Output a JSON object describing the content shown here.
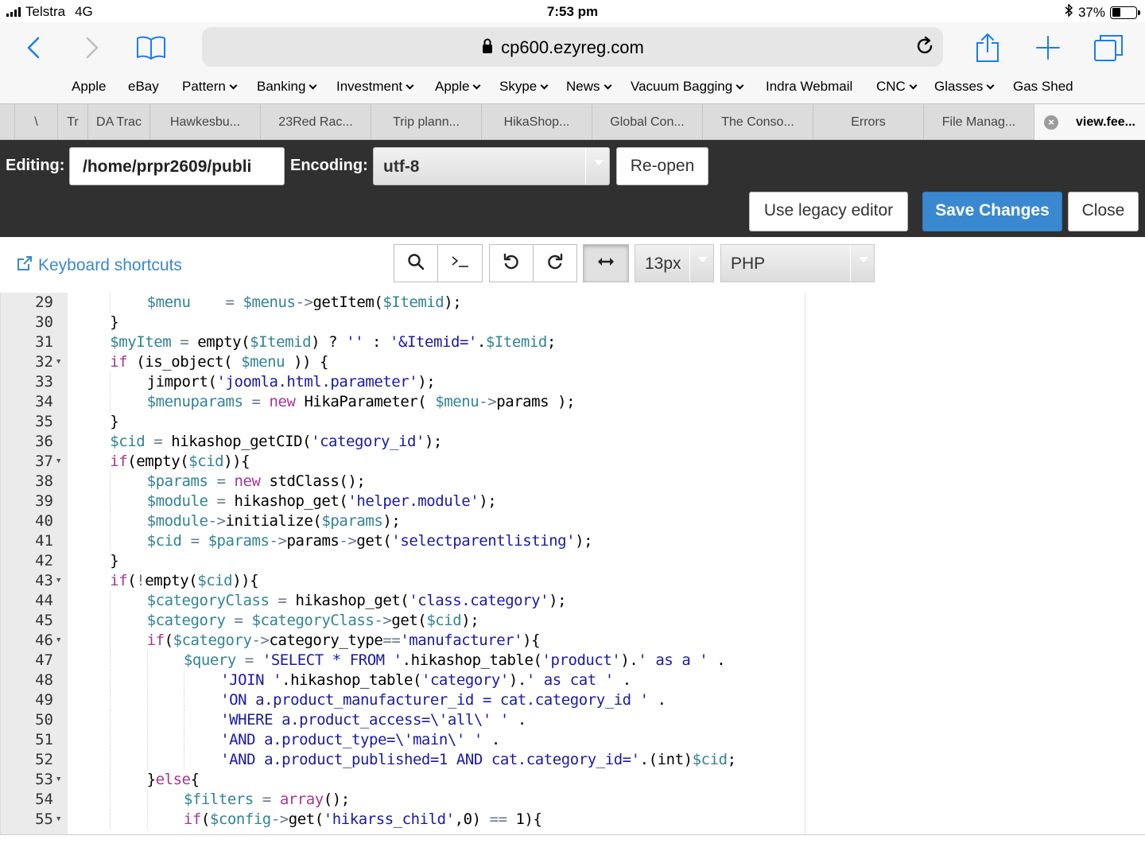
{
  "status_bar": {
    "carrier": "Telstra",
    "network": "4G",
    "time": "7:53 pm",
    "battery": "37%",
    "battery_level": 0.37
  },
  "browser": {
    "url": "cp600.ezyreg.com",
    "favorites": [
      {
        "label": "Apple",
        "dropdown": false
      },
      {
        "label": "eBay",
        "dropdown": false
      },
      {
        "label": "Pattern",
        "dropdown": true
      },
      {
        "label": "Banking",
        "dropdown": true
      },
      {
        "label": "Investment",
        "dropdown": true
      },
      {
        "label": "Apple",
        "dropdown": true
      },
      {
        "label": "Skype",
        "dropdown": true
      },
      {
        "label": "News",
        "dropdown": true
      },
      {
        "label": "Vacuum Bagging",
        "dropdown": true
      },
      {
        "label": "Indra Webmail",
        "dropdown": false
      },
      {
        "label": "CNC",
        "dropdown": true
      },
      {
        "label": "Glasses",
        "dropdown": true
      },
      {
        "label": "Gas Shed",
        "dropdown": false
      }
    ],
    "tabs": [
      {
        "label": "\\"
      },
      {
        "label": "Tr"
      },
      {
        "label": "DA Trac"
      },
      {
        "label": "Hawkesbu..."
      },
      {
        "label": "23Red Rac..."
      },
      {
        "label": "Trip plann..."
      },
      {
        "label": "HikaShop..."
      },
      {
        "label": "Global Con..."
      },
      {
        "label": "The Conso..."
      },
      {
        "label": "Errors"
      },
      {
        "label": "File Manag..."
      },
      {
        "label": "view.fee..."
      }
    ]
  },
  "editor_header": {
    "editing_label": "Editing:",
    "path": "/home/prpr2609/publi",
    "encoding_label": "Encoding:",
    "encoding": "utf-8",
    "reopen": "Re-open",
    "legacy": "Use legacy editor",
    "save": "Save Changes",
    "close": "Close"
  },
  "toolbar": {
    "shortcuts": "Keyboard shortcuts",
    "font_size": "13px",
    "mode": "PHP"
  },
  "code_lines": [
    {
      "n": "29",
      "fold": false,
      "indent": 2,
      "tokens": [
        [
          "var",
          "$menu"
        ],
        [
          "",
          "    "
        ],
        [
          "op",
          "="
        ],
        [
          "",
          " "
        ],
        [
          "var",
          "$menus"
        ],
        [
          "op",
          "->"
        ],
        [
          "",
          "getItem("
        ],
        [
          "var",
          "$Itemid"
        ],
        [
          "",
          ");"
        ]
      ]
    },
    {
      "n": "30",
      "fold": false,
      "indent": 1,
      "tokens": [
        [
          "",
          "}"
        ]
      ]
    },
    {
      "n": "31",
      "fold": false,
      "indent": 1,
      "tokens": [
        [
          "var",
          "$myItem"
        ],
        [
          "",
          " "
        ],
        [
          "op",
          "="
        ],
        [
          "",
          " empty("
        ],
        [
          "var",
          "$Itemid"
        ],
        [
          "",
          ") ? "
        ],
        [
          "str",
          "''"
        ],
        [
          "",
          " : "
        ],
        [
          "str",
          "'&Itemid='"
        ],
        [
          "",
          "."
        ],
        [
          "var",
          "$Itemid"
        ],
        [
          "",
          ";"
        ]
      ]
    },
    {
      "n": "32",
      "fold": true,
      "indent": 1,
      "tokens": [
        [
          "kw",
          "if"
        ],
        [
          "",
          " (is_object( "
        ],
        [
          "var",
          "$menu"
        ],
        [
          "",
          " )) {"
        ]
      ]
    },
    {
      "n": "33",
      "fold": false,
      "indent": 2,
      "tokens": [
        [
          "",
          "jimport("
        ],
        [
          "str",
          "'joomla.html.parameter'"
        ],
        [
          "",
          ");"
        ]
      ]
    },
    {
      "n": "34",
      "fold": false,
      "indent": 2,
      "tokens": [
        [
          "var",
          "$menuparams"
        ],
        [
          "",
          " "
        ],
        [
          "op",
          "="
        ],
        [
          "",
          " "
        ],
        [
          "kw",
          "new"
        ],
        [
          "",
          " HikaParameter( "
        ],
        [
          "var",
          "$menu"
        ],
        [
          "op",
          "->"
        ],
        [
          "",
          "params );"
        ]
      ]
    },
    {
      "n": "35",
      "fold": false,
      "indent": 1,
      "tokens": [
        [
          "",
          "}"
        ]
      ]
    },
    {
      "n": "36",
      "fold": false,
      "indent": 1,
      "tokens": [
        [
          "var",
          "$cid"
        ],
        [
          "",
          " "
        ],
        [
          "op",
          "="
        ],
        [
          "",
          " hikashop_getCID("
        ],
        [
          "str",
          "'category_id'"
        ],
        [
          "",
          ");"
        ]
      ]
    },
    {
      "n": "37",
      "fold": true,
      "indent": 1,
      "tokens": [
        [
          "kw",
          "if"
        ],
        [
          "",
          "(empty("
        ],
        [
          "var",
          "$cid"
        ],
        [
          "",
          "))"
        ],
        [
          "",
          "{"
        ]
      ]
    },
    {
      "n": "38",
      "fold": false,
      "indent": 2,
      "tokens": [
        [
          "var",
          "$params"
        ],
        [
          "",
          " "
        ],
        [
          "op",
          "="
        ],
        [
          "",
          " "
        ],
        [
          "kw",
          "new"
        ],
        [
          "",
          " stdClass();"
        ]
      ]
    },
    {
      "n": "39",
      "fold": false,
      "indent": 2,
      "tokens": [
        [
          "var",
          "$module"
        ],
        [
          "",
          " "
        ],
        [
          "op",
          "="
        ],
        [
          "",
          " hikashop_get("
        ],
        [
          "str",
          "'helper.module'"
        ],
        [
          "",
          ");"
        ]
      ]
    },
    {
      "n": "40",
      "fold": false,
      "indent": 2,
      "tokens": [
        [
          "var",
          "$module"
        ],
        [
          "op",
          "->"
        ],
        [
          "",
          "initialize("
        ],
        [
          "var",
          "$params"
        ],
        [
          "",
          ");"
        ]
      ]
    },
    {
      "n": "41",
      "fold": false,
      "indent": 2,
      "tokens": [
        [
          "var",
          "$cid"
        ],
        [
          "",
          " "
        ],
        [
          "op",
          "="
        ],
        [
          "",
          " "
        ],
        [
          "var",
          "$params"
        ],
        [
          "op",
          "->"
        ],
        [
          "",
          "params"
        ],
        [
          "op",
          "->"
        ],
        [
          "",
          "get("
        ],
        [
          "str",
          "'selectparentlisting'"
        ],
        [
          "",
          ");"
        ]
      ]
    },
    {
      "n": "42",
      "fold": false,
      "indent": 1,
      "tokens": [
        [
          "",
          "}"
        ]
      ]
    },
    {
      "n": "43",
      "fold": true,
      "indent": 1,
      "tokens": [
        [
          "kw",
          "if"
        ],
        [
          "",
          "("
        ],
        [
          "op",
          "!"
        ],
        [
          "",
          "empty("
        ],
        [
          "var",
          "$cid"
        ],
        [
          "",
          "))"
        ],
        [
          "",
          "{"
        ]
      ]
    },
    {
      "n": "44",
      "fold": false,
      "indent": 2,
      "tokens": [
        [
          "var",
          "$categoryClass"
        ],
        [
          "",
          " "
        ],
        [
          "op",
          "="
        ],
        [
          "",
          " hikashop_get("
        ],
        [
          "str",
          "'class.category'"
        ],
        [
          "",
          ");"
        ]
      ]
    },
    {
      "n": "45",
      "fold": false,
      "indent": 2,
      "tokens": [
        [
          "var",
          "$category"
        ],
        [
          "",
          " "
        ],
        [
          "op",
          "="
        ],
        [
          "",
          " "
        ],
        [
          "var",
          "$categoryClass"
        ],
        [
          "op",
          "->"
        ],
        [
          "",
          "get("
        ],
        [
          "var",
          "$cid"
        ],
        [
          "",
          ");"
        ]
      ]
    },
    {
      "n": "46",
      "fold": true,
      "indent": 2,
      "tokens": [
        [
          "kw",
          "if"
        ],
        [
          "",
          "("
        ],
        [
          "var",
          "$category"
        ],
        [
          "op",
          "->"
        ],
        [
          "",
          "category_type"
        ],
        [
          "op",
          "=="
        ],
        [
          "str",
          "'manufacturer'"
        ],
        [
          "",
          "){"
        ]
      ]
    },
    {
      "n": "47",
      "fold": false,
      "indent": 3,
      "tokens": [
        [
          "var",
          "$query"
        ],
        [
          "",
          " "
        ],
        [
          "op",
          "="
        ],
        [
          "",
          " "
        ],
        [
          "str",
          "'SELECT * FROM '"
        ],
        [
          "",
          ".hikashop_table("
        ],
        [
          "str",
          "'product'"
        ],
        [
          "",
          ")."
        ],
        [
          "str",
          "' as a '"
        ],
        [
          "",
          " ."
        ]
      ]
    },
    {
      "n": "48",
      "fold": false,
      "indent": 4,
      "tokens": [
        [
          "str",
          "'JOIN '"
        ],
        [
          "",
          ".hikashop_table("
        ],
        [
          "str",
          "'category'"
        ],
        [
          "",
          ")."
        ],
        [
          "str",
          "' as cat '"
        ],
        [
          "",
          " ."
        ]
      ]
    },
    {
      "n": "49",
      "fold": false,
      "indent": 4,
      "tokens": [
        [
          "str",
          "'ON a.product_manufacturer_id = cat.category_id '"
        ],
        [
          "",
          " ."
        ]
      ]
    },
    {
      "n": "50",
      "fold": false,
      "indent": 4,
      "tokens": [
        [
          "str",
          "'WHERE a.product_access=\\'all\\' '"
        ],
        [
          "",
          " ."
        ]
      ]
    },
    {
      "n": "51",
      "fold": false,
      "indent": 4,
      "tokens": [
        [
          "str",
          "'AND a.product_type=\\'main\\' '"
        ],
        [
          "",
          " ."
        ]
      ]
    },
    {
      "n": "52",
      "fold": false,
      "indent": 4,
      "tokens": [
        [
          "str",
          "'AND a.product_published=1 AND cat.category_id='"
        ],
        [
          "",
          ".(int)"
        ],
        [
          "var",
          "$cid"
        ],
        [
          "",
          ";"
        ]
      ]
    },
    {
      "n": "53",
      "fold": true,
      "indent": 2,
      "tokens": [
        [
          "",
          "}"
        ],
        [
          "kw",
          "else"
        ],
        [
          "",
          "{"
        ]
      ]
    },
    {
      "n": "54",
      "fold": false,
      "indent": 3,
      "tokens": [
        [
          "var",
          "$filters"
        ],
        [
          "",
          " "
        ],
        [
          "op",
          "="
        ],
        [
          "",
          " "
        ],
        [
          "kw",
          "array"
        ],
        [
          "",
          "();"
        ]
      ]
    },
    {
      "n": "55",
      "fold": true,
      "indent": 3,
      "tokens": [
        [
          "kw",
          "if"
        ],
        [
          "",
          "("
        ],
        [
          "var",
          "$config"
        ],
        [
          "op",
          "->"
        ],
        [
          "",
          "get("
        ],
        [
          "str",
          "'hikarss_child'"
        ],
        [
          "",
          ",0) "
        ],
        [
          "op",
          "=="
        ],
        [
          "",
          " 1){"
        ]
      ]
    }
  ]
}
